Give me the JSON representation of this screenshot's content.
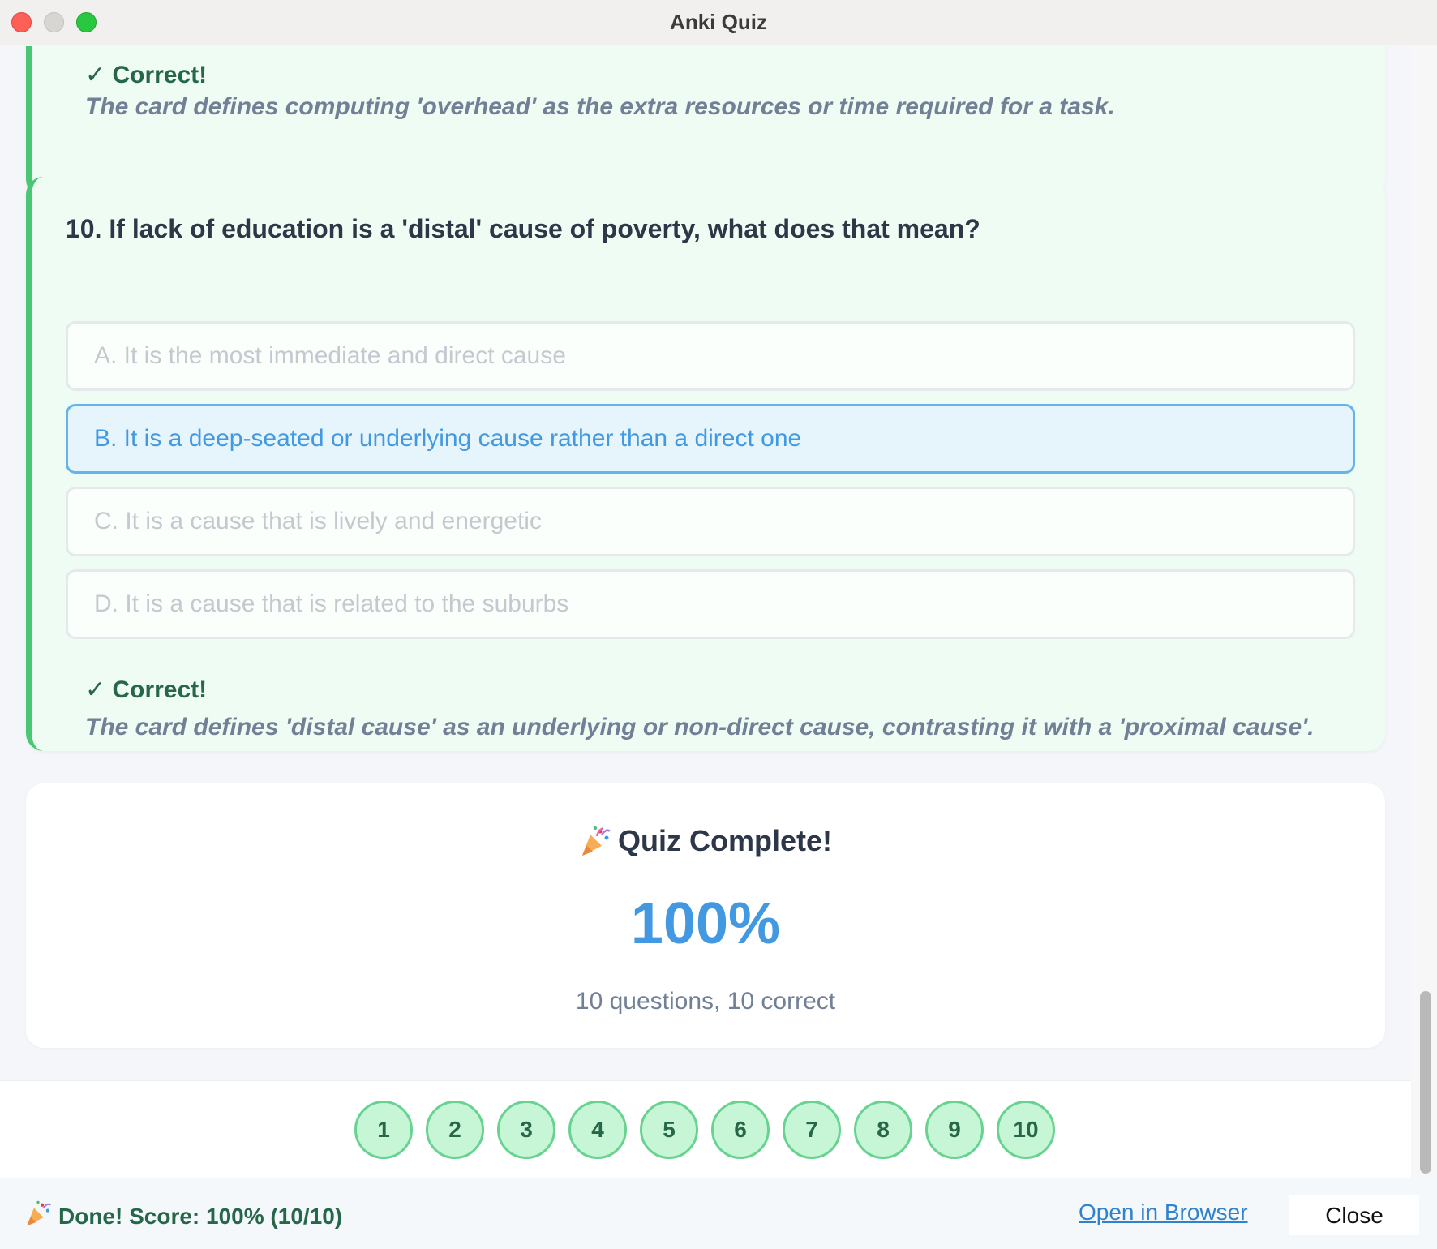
{
  "window": {
    "title": "Anki Quiz"
  },
  "previous_question": {
    "feedback_title": "✓ Correct!",
    "explanation": "The card defines computing 'overhead' as the extra resources or time required for a task."
  },
  "question": {
    "text": "10. If lack of education is a 'distal' cause of poverty, what does that mean?",
    "options": [
      {
        "label": "A. It is the most immediate and direct cause",
        "state": "unselected"
      },
      {
        "label": "B. It is a deep-seated or underlying cause rather than a direct one",
        "state": "selected"
      },
      {
        "label": "C. It is a cause that is lively and energetic",
        "state": "unselected"
      },
      {
        "label": "D. It is a cause that is related to the suburbs",
        "state": "unselected"
      }
    ],
    "feedback_title": "✓ Correct!",
    "explanation": "The card defines 'distal cause' as an underlying or non-direct cause, contrasting it with a 'proximal cause'."
  },
  "result": {
    "title": "Quiz Complete!",
    "icon": "party-popper-icon",
    "score": "100%",
    "summary": "10 questions, 10 correct"
  },
  "question_nav": [
    "1",
    "2",
    "3",
    "4",
    "5",
    "6",
    "7",
    "8",
    "9",
    "10"
  ],
  "footer": {
    "status": "Done! Score: 100% (10/10)",
    "open_link": "Open in Browser",
    "close_label": "Close"
  },
  "colors": {
    "correct_green": "#48c774",
    "selected_blue": "#63b3ed",
    "score_blue": "#4299e1"
  }
}
